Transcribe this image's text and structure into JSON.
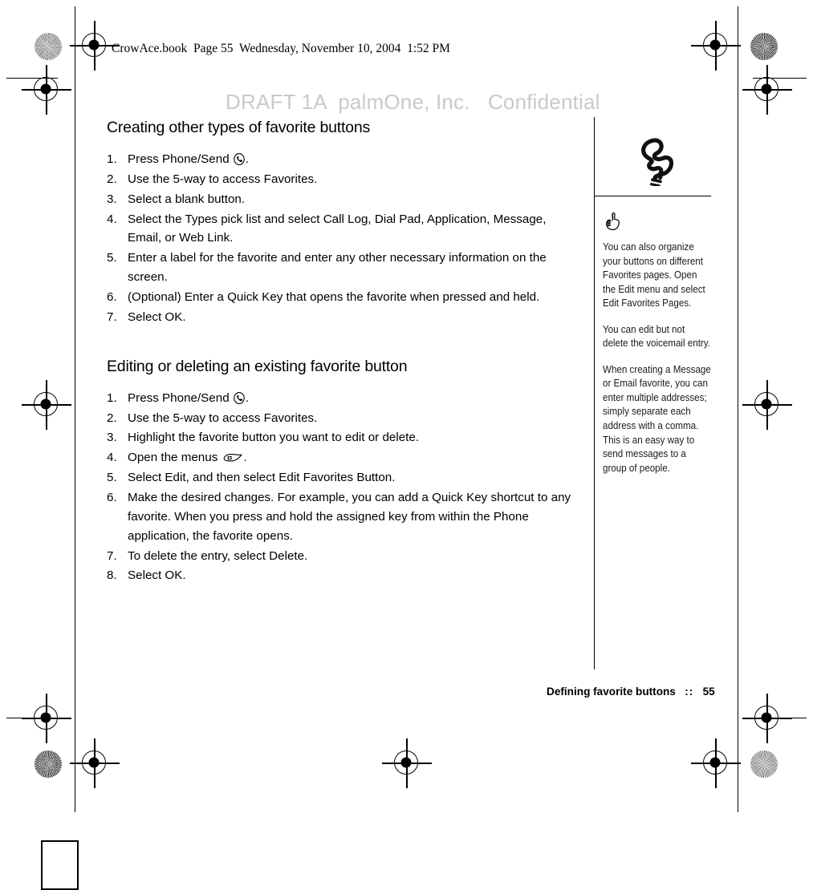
{
  "header": {
    "book_line": "CrowAce.book  Page 55  Wednesday, November 10, 2004  1:52 PM"
  },
  "watermark": {
    "text": "DRAFT 1A  palmOne, Inc.   Confidential",
    "color": "#c9c9c9"
  },
  "main": {
    "sections": [
      {
        "heading": "Creating other types of favorite buttons",
        "steps": [
          {
            "num": "1.",
            "text_before": "Press Phone/Send ",
            "icon": "phone-send-icon",
            "text_after": "."
          },
          {
            "num": "2.",
            "text_before": "Use the 5-way to access Favorites.",
            "icon": null,
            "text_after": ""
          },
          {
            "num": "3.",
            "text_before": "Select a blank button.",
            "icon": null,
            "text_after": ""
          },
          {
            "num": "4.",
            "text_before": "Select the Types pick list and select Call Log, Dial Pad, Application, Message, Email, or Web Link.",
            "icon": null,
            "text_after": ""
          },
          {
            "num": "5.",
            "text_before": "Enter a label for the favorite and enter any other necessary information on the  screen.",
            "icon": null,
            "text_after": ""
          },
          {
            "num": "6.",
            "text_before": "(Optional) Enter a Quick Key that opens the favorite when pressed and held.",
            "icon": null,
            "text_after": ""
          },
          {
            "num": "7.",
            "text_before": "Select OK.",
            "icon": null,
            "text_after": ""
          }
        ]
      },
      {
        "heading": "Editing or deleting an existing favorite button",
        "steps": [
          {
            "num": "1.",
            "text_before": "Press Phone/Send ",
            "icon": "phone-send-icon",
            "text_after": "."
          },
          {
            "num": "2.",
            "text_before": "Use the 5-way to access Favorites.",
            "icon": null,
            "text_after": ""
          },
          {
            "num": "3.",
            "text_before": "Highlight the favorite button you want to edit or delete.",
            "icon": null,
            "text_after": ""
          },
          {
            "num": "4.",
            "text_before": "Open the menus  ",
            "icon": "menu-icon",
            "text_after": "."
          },
          {
            "num": "5.",
            "text_before": "Select Edit, and then select Edit Favorites Button.",
            "icon": null,
            "text_after": ""
          },
          {
            "num": "6.",
            "text_before": "Make the desired changes. For example, you can add a Quick Key shortcut to any  favorite. When you press and hold the assigned key from within the Phone application, the favorite opens.",
            "icon": null,
            "text_after": ""
          },
          {
            "num": "7.",
            "text_before": "To delete the entry, select Delete.",
            "icon": null,
            "text_after": ""
          },
          {
            "num": "8.",
            "text_before": "Select OK.",
            "icon": null,
            "text_after": ""
          }
        ]
      }
    ]
  },
  "sidebar": {
    "chapter_icon": "phone-handset-icon",
    "tip_icon": "pointing-hand-tip-icon",
    "tips": [
      "You can also organize your buttons on different Favorites pages. Open the Edit menu and select Edit Favorites Pages.",
      "You can edit but not delete the voicemail entry.",
      "When creating a Message or Email favorite, you can enter multiple addresses; simply separate each address with a comma. This is an easy way to send messages to a group of people."
    ]
  },
  "footer": {
    "title": "Defining favorite buttons",
    "separator": "::",
    "page_number": "55"
  }
}
